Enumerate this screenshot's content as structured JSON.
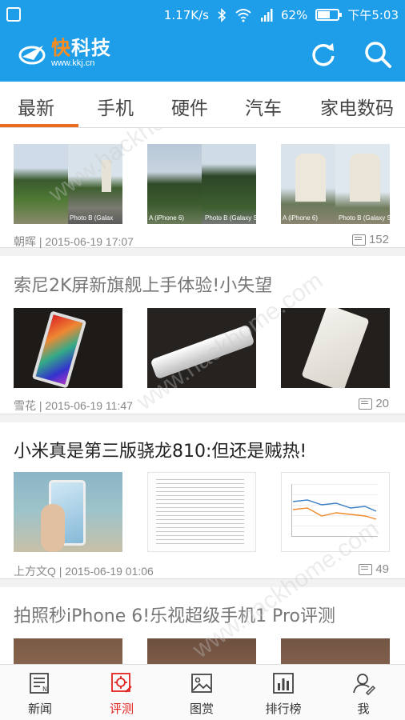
{
  "status_bar": {
    "speed": "1.17K/s",
    "battery": "62%",
    "battery_level": 0.62,
    "time": "下午5:03"
  },
  "app_bar": {
    "logo_title_first": "快",
    "logo_title_rest": "科技",
    "logo_url": "www.kkj.cn"
  },
  "tabs": [
    "最新",
    "手机",
    "硬件",
    "汽车",
    "家电数码"
  ],
  "articles": [
    {
      "title": "",
      "meta": "朝晖 | 2015-06-19 17:07",
      "comments": "152",
      "thumb_labels": [
        "Photo B (Galax",
        "A (iPhone 6)",
        "Photo B (Galaxy S6)",
        "A (iPhone 6)",
        "Photo B (Galaxy S6)"
      ]
    },
    {
      "title": "索尼2K屏新旗舰上手体验!小失望",
      "meta": "雪花 | 2015-06-19 11:47",
      "comments": "20"
    },
    {
      "title": "小米真是第三版骁龙810:但还是贼热!",
      "meta": "上方文Q | 2015-06-19 01:06",
      "comments": "49"
    },
    {
      "title": "拍照秒iPhone 6!乐视超级手机1 Pro评测",
      "meta": "",
      "comments": ""
    }
  ],
  "bottom_nav": [
    {
      "label": "新闻",
      "icon": "news-icon"
    },
    {
      "label": "评测",
      "icon": "review-icon"
    },
    {
      "label": "图赏",
      "icon": "gallery-icon"
    },
    {
      "label": "排行榜",
      "icon": "ranking-icon"
    },
    {
      "label": "我",
      "icon": "profile-icon"
    }
  ],
  "watermark": "www.hackhome.com",
  "colors": {
    "primary": "#1e9ee8",
    "accent": "#ec6b1e",
    "active_nav": "#e2241f"
  }
}
